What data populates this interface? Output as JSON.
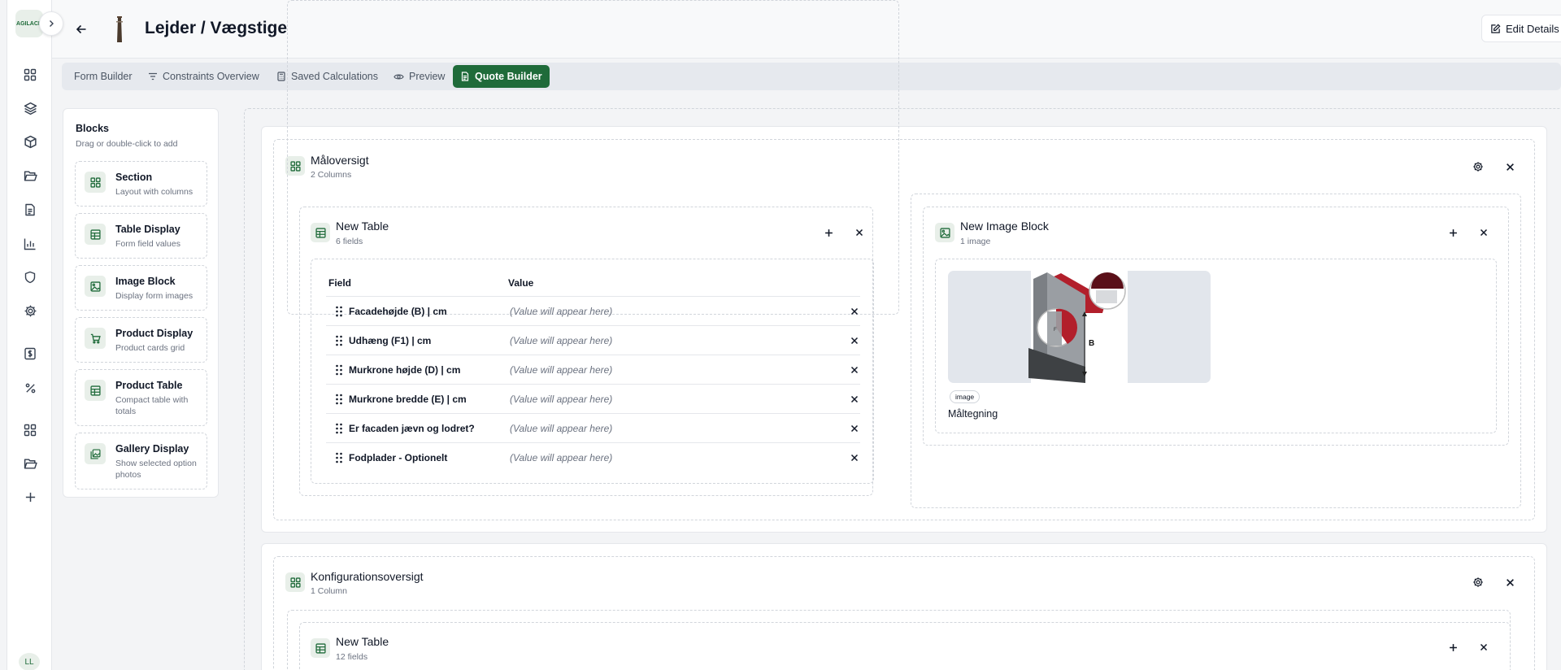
{
  "app": {
    "logo_text": "AGILACK",
    "user_initials": "LL"
  },
  "header": {
    "title": "Lejder / Vægstige",
    "edit_label": "Edit Details"
  },
  "tabs": [
    {
      "label": "Form Builder",
      "icon": "none"
    },
    {
      "label": "Constraints Overview",
      "icon": "filter-icon"
    },
    {
      "label": "Saved Calculations",
      "icon": "calculator-icon"
    },
    {
      "label": "Preview",
      "icon": "eye-icon"
    },
    {
      "label": "Quote Builder",
      "icon": "document-icon",
      "active": true
    }
  ],
  "palette": {
    "title": "Blocks",
    "subtitle": "Drag or double-click to add",
    "items": [
      {
        "name": "Section",
        "desc": "Layout with columns",
        "icon": "grid-icon"
      },
      {
        "name": "Table Display",
        "desc": "Form field values",
        "icon": "table-icon"
      },
      {
        "name": "Image Block",
        "desc": "Display form images",
        "icon": "image-icon"
      },
      {
        "name": "Product Display",
        "desc": "Product cards grid",
        "icon": "cart-icon"
      },
      {
        "name": "Product Table",
        "desc": "Compact table with totals",
        "icon": "table-icon"
      },
      {
        "name": "Gallery Display",
        "desc": "Show selected option photos",
        "icon": "gallery-icon"
      }
    ]
  },
  "sections": [
    {
      "title": "Måloversigt",
      "subtitle": "2 Columns",
      "table": {
        "title": "New Table",
        "subtitle": "6 fields",
        "col_field": "Field",
        "col_value": "Value",
        "rows": [
          {
            "field": "Facadehøjde (B) | cm",
            "value": "(Value will appear here)"
          },
          {
            "field": "Udhæng (F1) | cm",
            "value": "(Value will appear here)"
          },
          {
            "field": "Murkrone højde (D) | cm",
            "value": "(Value will appear here)"
          },
          {
            "field": "Murkrone bredde (E) | cm",
            "value": "(Value will appear here)"
          },
          {
            "field": "Er facaden jævn og lodret?",
            "value": "(Value will appear here)"
          },
          {
            "field": "Fodplader - Optionelt",
            "value": "(Value will appear here)"
          }
        ]
      },
      "image_block": {
        "title": "New Image Block",
        "subtitle": "1 image",
        "badge": "image",
        "caption": "Måltegning",
        "drawing_letter": "B"
      }
    },
    {
      "title": "Konfigurationsoversigt",
      "subtitle": "1 Column",
      "table": {
        "title": "New Table",
        "subtitle": "12 fields"
      }
    }
  ],
  "colors": {
    "brand": "#1f6b3a",
    "icon_bg": "#e8efe9",
    "drawing_red": "#b21f2b",
    "drawing_grey": "#8b8f94"
  }
}
